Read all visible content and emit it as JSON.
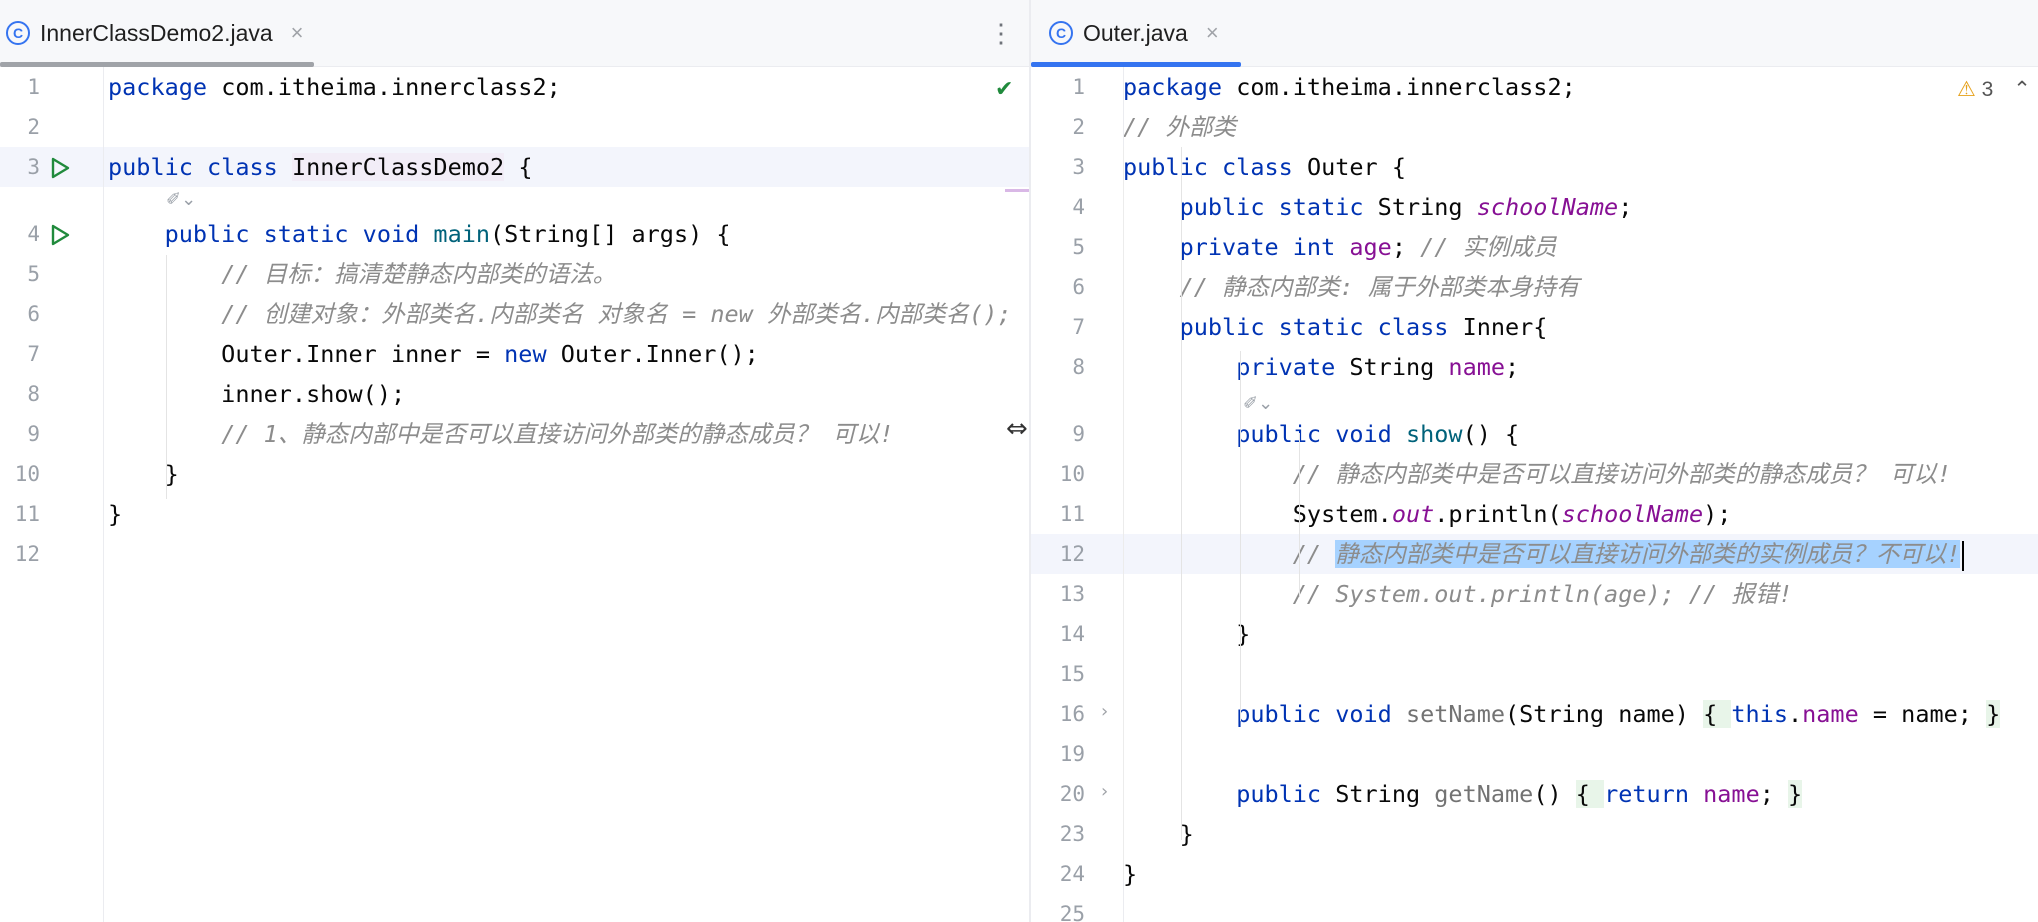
{
  "left_pane": {
    "tab": {
      "icon": "java-class-icon",
      "icon_glyph": "C",
      "title": "InnerClassDemo2.java",
      "close": "×"
    },
    "menu_glyph": "⋮",
    "status_glyph": "✔",
    "hint_glyph": "✐⌄",
    "lines": [
      {
        "num": "1",
        "segs": [
          [
            "kw",
            "package "
          ],
          [
            "",
            "com.itheima.innerclass2;"
          ]
        ]
      },
      {
        "num": "2",
        "segs": []
      },
      {
        "num": "3",
        "segs": [
          [
            "kw",
            "public class "
          ],
          [
            "hlcls",
            "InnerClassDemo2"
          ],
          [
            "",
            " {"
          ]
        ]
      },
      {
        "num": "4",
        "segs": [
          [
            "",
            "    "
          ],
          [
            "kw",
            "public static void "
          ],
          [
            "mth",
            "main"
          ],
          [
            "",
            "(String[] args) {"
          ]
        ]
      },
      {
        "num": "5",
        "segs": [
          [
            "",
            "        "
          ],
          [
            "cm",
            "// 目标：搞清楚静态内部类的语法。"
          ]
        ]
      },
      {
        "num": "6",
        "segs": [
          [
            "",
            "        "
          ],
          [
            "cm",
            "// 创建对象：外部类名.内部类名 对象名 = new 外部类名.内部类名();"
          ]
        ]
      },
      {
        "num": "7",
        "segs": [
          [
            "",
            "        Outer.Inner inner = "
          ],
          [
            "kw",
            "new "
          ],
          [
            "",
            "Outer.Inner();"
          ]
        ]
      },
      {
        "num": "8",
        "segs": [
          [
            "",
            "        inner.show();"
          ]
        ]
      },
      {
        "num": "9",
        "segs": [
          [
            "",
            "        "
          ],
          [
            "cm",
            "// 1、静态内部中是否可以直接访问外部类的静态成员？ 可以!"
          ]
        ]
      },
      {
        "num": "10",
        "segs": [
          [
            "",
            "    }"
          ]
        ]
      },
      {
        "num": "11",
        "segs": [
          [
            "",
            "}"
          ]
        ]
      },
      {
        "num": "12",
        "segs": []
      }
    ]
  },
  "right_pane": {
    "tab": {
      "icon": "java-class-icon",
      "icon_glyph": "C",
      "title": "Outer.java",
      "close": "×"
    },
    "warning_glyph": "⚠",
    "warning_count": "3",
    "collapse_glyph": "⌃",
    "hint_glyph": "✐⌄",
    "fold_glyph": "›",
    "resize_glyph": "⇔",
    "lines": [
      {
        "num": "1",
        "segs": [
          [
            "kw",
            "package "
          ],
          [
            "",
            "com.itheima.innerclass2;"
          ]
        ]
      },
      {
        "num": "2",
        "segs": [
          [
            "cm",
            "// 外部类"
          ]
        ]
      },
      {
        "num": "3",
        "segs": [
          [
            "kw",
            "public class "
          ],
          [
            "",
            "Outer {"
          ]
        ]
      },
      {
        "num": "4",
        "segs": [
          [
            "",
            "    "
          ],
          [
            "kw",
            "public static "
          ],
          [
            "",
            "String "
          ],
          [
            "sfld",
            "schoolName"
          ],
          [
            "",
            ";"
          ]
        ]
      },
      {
        "num": "5",
        "segs": [
          [
            "",
            "    "
          ],
          [
            "kw",
            "private int "
          ],
          [
            "fld",
            "age"
          ],
          [
            "",
            "; "
          ],
          [
            "cm",
            "// 实例成员"
          ]
        ]
      },
      {
        "num": "6",
        "segs": [
          [
            "",
            "    "
          ],
          [
            "cm",
            "// 静态内部类: 属于外部类本身持有"
          ]
        ]
      },
      {
        "num": "7",
        "segs": [
          [
            "",
            "    "
          ],
          [
            "kw",
            "public static class "
          ],
          [
            "",
            "Inner{"
          ]
        ]
      },
      {
        "num": "8",
        "segs": [
          [
            "",
            "        "
          ],
          [
            "kw",
            "private "
          ],
          [
            "",
            "String "
          ],
          [
            "fld",
            "name"
          ],
          [
            "",
            ";"
          ]
        ]
      },
      {
        "num": "9",
        "segs": [
          [
            "",
            "        "
          ],
          [
            "kw",
            "public void "
          ],
          [
            "mth",
            "show"
          ],
          [
            "",
            "() {"
          ]
        ]
      },
      {
        "num": "10",
        "segs": [
          [
            "",
            "            "
          ],
          [
            "cm",
            "// 静态内部类中是否可以直接访问外部类的静态成员？ 可以!"
          ]
        ]
      },
      {
        "num": "11",
        "segs": [
          [
            "",
            "            System."
          ],
          [
            "sfld",
            "out"
          ],
          [
            "",
            ".println("
          ],
          [
            "sfld",
            "schoolName"
          ],
          [
            "",
            ");"
          ]
        ]
      },
      {
        "num": "12",
        "segs": [
          [
            "",
            "            "
          ],
          [
            "cm",
            "// "
          ],
          [
            "cm sel",
            "静态内部类中是否可以直接访问外部类的实例成员？不可以!"
          ]
        ]
      },
      {
        "num": "13",
        "segs": [
          [
            "",
            "            "
          ],
          [
            "cm",
            "// System.out.println(age); // 报错!"
          ]
        ]
      },
      {
        "num": "14",
        "segs": [
          [
            "",
            "        }"
          ]
        ]
      },
      {
        "num": "15",
        "segs": []
      },
      {
        "num": "16",
        "segs": [
          [
            "",
            "        "
          ],
          [
            "kw",
            "public void "
          ],
          [
            "gry",
            "setName"
          ],
          [
            "",
            "(String name) "
          ],
          [
            "brace",
            "{ "
          ],
          [
            "kw",
            "this"
          ],
          [
            "",
            "."
          ],
          [
            "fld",
            "name"
          ],
          [
            "",
            " = name; "
          ],
          [
            "brace",
            "}"
          ]
        ]
      },
      {
        "num": "19",
        "segs": []
      },
      {
        "num": "20",
        "segs": [
          [
            "",
            "        "
          ],
          [
            "kw",
            "public "
          ],
          [
            "",
            "String "
          ],
          [
            "gry",
            "getName"
          ],
          [
            "",
            "() "
          ],
          [
            "brace",
            "{ "
          ],
          [
            "kw",
            "return "
          ],
          [
            "fld",
            "name"
          ],
          [
            "",
            "; "
          ],
          [
            "brace",
            "}"
          ]
        ]
      },
      {
        "num": "23",
        "segs": [
          [
            "",
            "    }"
          ]
        ]
      },
      {
        "num": "24",
        "segs": [
          [
            "",
            "}"
          ]
        ]
      },
      {
        "num": "25",
        "segs": []
      }
    ]
  },
  "colors": {
    "keyword": "#0033b3",
    "comment": "#8c8c8c",
    "field": "#871094",
    "method": "#00627a",
    "run_green": "#208a3c",
    "accent_blue": "#3574f0",
    "selection": "#a6d2ff"
  }
}
